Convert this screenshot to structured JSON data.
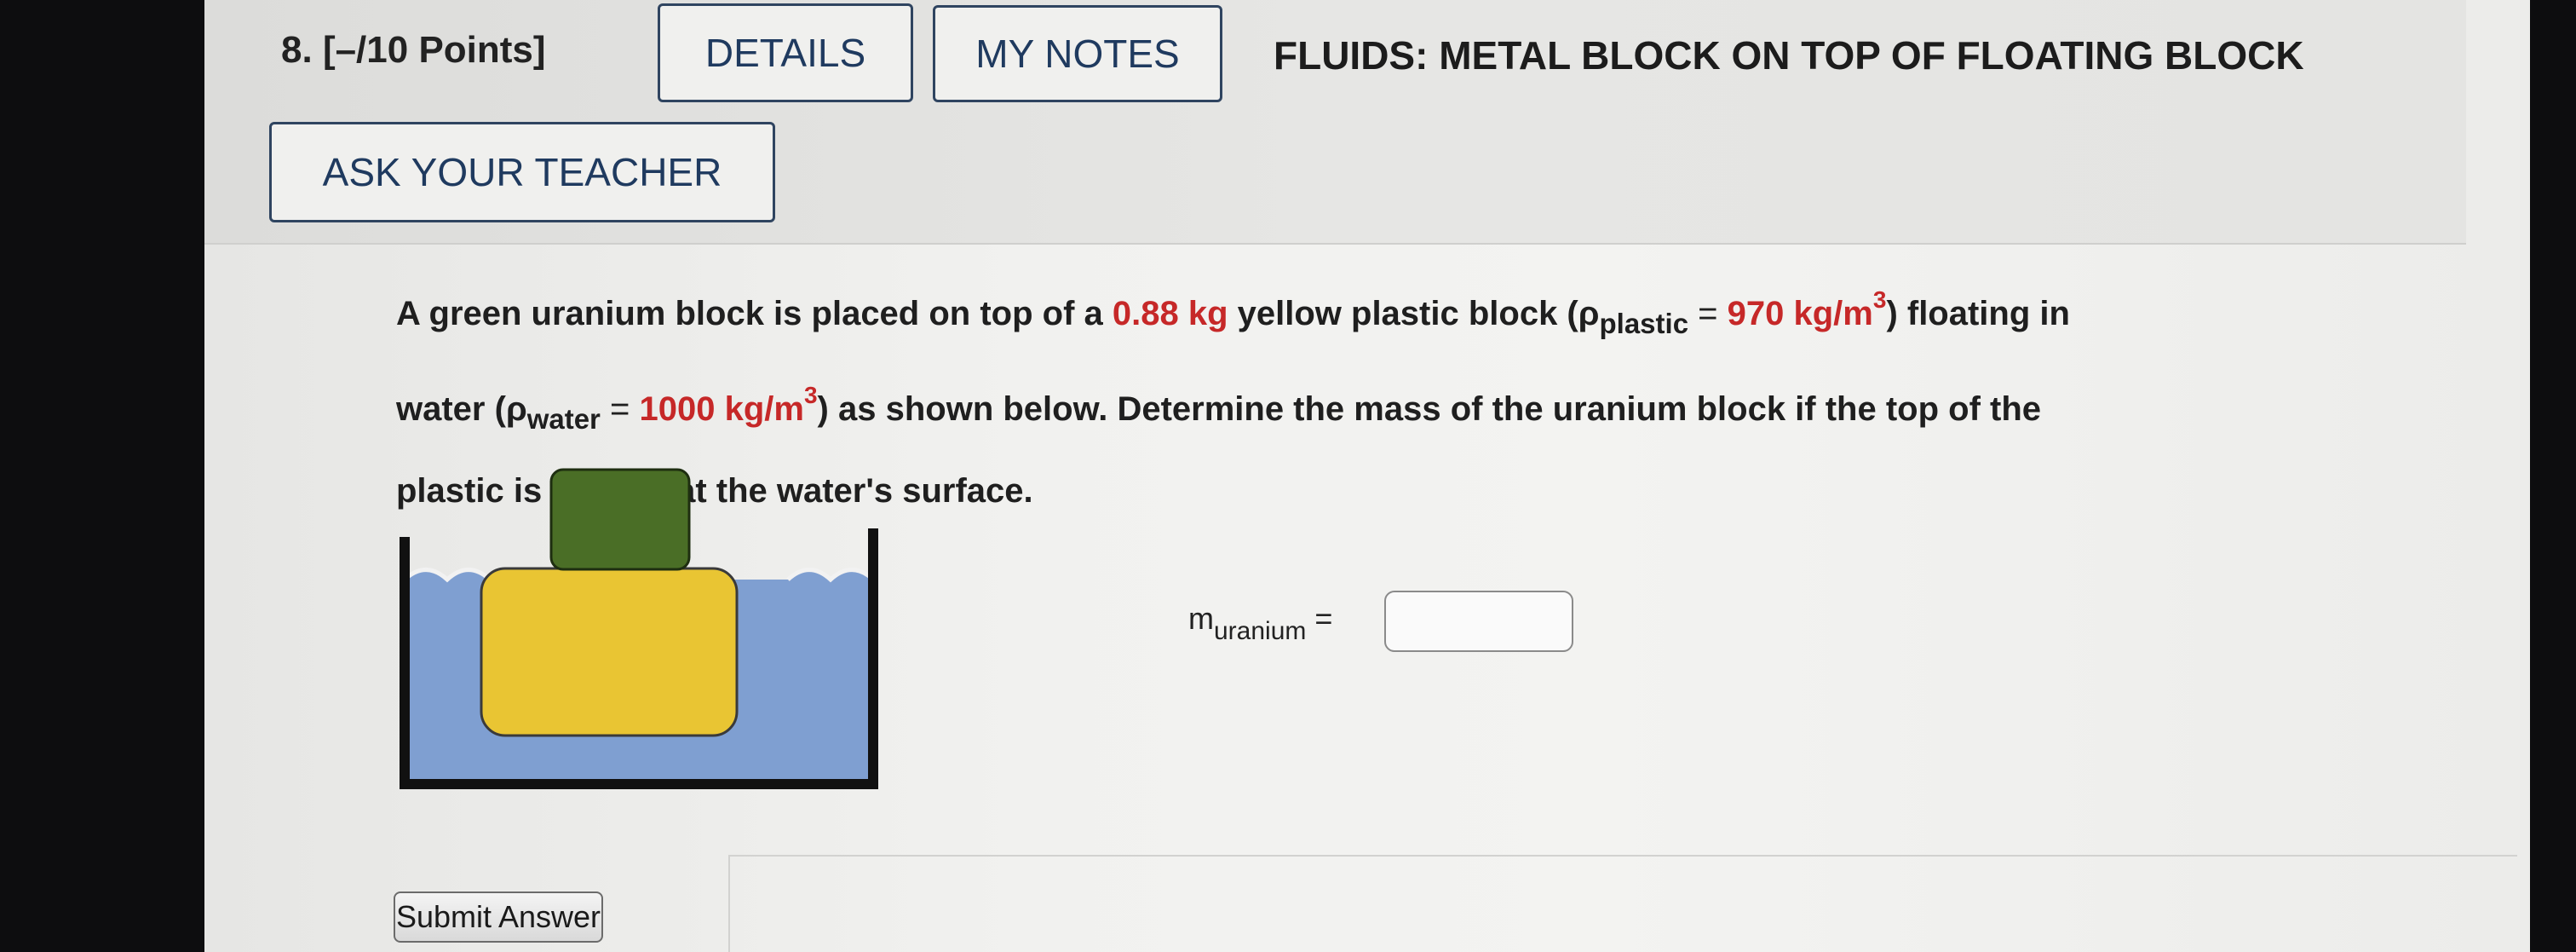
{
  "header": {
    "question_number": "8.",
    "points": "[–/10 Points]",
    "details_label": "DETAILS",
    "notes_label": "MY NOTES",
    "title": "FLUIDS: METAL BLOCK ON TOP OF FLOATING BLOCK",
    "ask_label": "ASK YOUR TEACHER"
  },
  "problem": {
    "t1": "A green uranium block is placed on top of a ",
    "mass": "0.88 kg",
    "t2": " yellow plastic block (",
    "rho": "ρ",
    "plastic_sub": "plastic",
    "eq": " = ",
    "plastic_density": "970 kg/m",
    "cube": "3",
    "t3": ") floating in",
    "t4": "water (",
    "water_sub": "water",
    "water_density": "1000 kg/m",
    "t5": ") as shown below. Determine the mass of the uranium block if the top of the",
    "t6": "plastic is exactly at the water's surface."
  },
  "answer": {
    "label_main": "m",
    "label_sub": "uranium",
    "label_eq": "=",
    "value": ""
  },
  "submit_label": "Submit Answer",
  "colors": {
    "button_border": "#2f4460",
    "highlight_red": "#c62828",
    "water": "#7f9fd1",
    "plastic_block": "#e9c533",
    "uranium_block": "#4a6e26"
  }
}
